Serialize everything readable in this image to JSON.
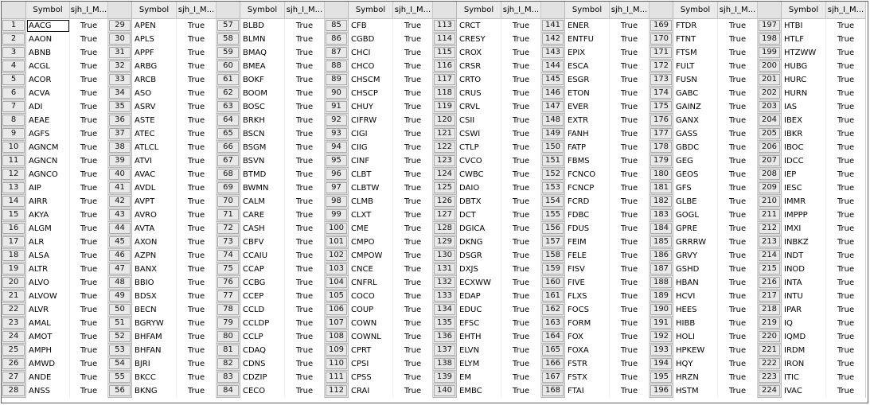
{
  "table": {
    "columns": {
      "symbol": "Symbol",
      "flag": "sjh_I_M..."
    },
    "rows": [
      {
        "idx": "1",
        "symbol": "AACG",
        "value": "True"
      },
      {
        "idx": "2",
        "symbol": "AAON",
        "value": "True"
      },
      {
        "idx": "3",
        "symbol": "ABNB",
        "value": "True"
      },
      {
        "idx": "4",
        "symbol": "ACGL",
        "value": "True"
      },
      {
        "idx": "5",
        "symbol": "ACOR",
        "value": "True"
      },
      {
        "idx": "6",
        "symbol": "ACVA",
        "value": "True"
      },
      {
        "idx": "7",
        "symbol": "ADI",
        "value": "True"
      },
      {
        "idx": "8",
        "symbol": "AEAE",
        "value": "True"
      },
      {
        "idx": "9",
        "symbol": "AGFS",
        "value": "True"
      },
      {
        "idx": "10",
        "symbol": "AGNCM",
        "value": "True"
      },
      {
        "idx": "11",
        "symbol": "AGNCN",
        "value": "True"
      },
      {
        "idx": "12",
        "symbol": "AGNCO",
        "value": "True"
      },
      {
        "idx": "13",
        "symbol": "AIP",
        "value": "True"
      },
      {
        "idx": "14",
        "symbol": "AIRR",
        "value": "True"
      },
      {
        "idx": "15",
        "symbol": "AKYA",
        "value": "True"
      },
      {
        "idx": "16",
        "symbol": "ALGM",
        "value": "True"
      },
      {
        "idx": "17",
        "symbol": "ALR",
        "value": "True"
      },
      {
        "idx": "18",
        "symbol": "ALSA",
        "value": "True"
      },
      {
        "idx": "19",
        "symbol": "ALTR",
        "value": "True"
      },
      {
        "idx": "20",
        "symbol": "ALVO",
        "value": "True"
      },
      {
        "idx": "21",
        "symbol": "ALVOW",
        "value": "True"
      },
      {
        "idx": "22",
        "symbol": "ALVR",
        "value": "True"
      },
      {
        "idx": "23",
        "symbol": "AMAL",
        "value": "True"
      },
      {
        "idx": "24",
        "symbol": "AMOT",
        "value": "True"
      },
      {
        "idx": "25",
        "symbol": "AMPH",
        "value": "True"
      },
      {
        "idx": "26",
        "symbol": "AMWD",
        "value": "True"
      },
      {
        "idx": "27",
        "symbol": "ANDE",
        "value": "True"
      },
      {
        "idx": "28",
        "symbol": "ANSS",
        "value": "True"
      },
      {
        "idx": "29",
        "symbol": "APEN",
        "value": "True"
      },
      {
        "idx": "30",
        "symbol": "APLS",
        "value": "True"
      },
      {
        "idx": "31",
        "symbol": "APPF",
        "value": "True"
      },
      {
        "idx": "32",
        "symbol": "ARBG",
        "value": "True"
      },
      {
        "idx": "33",
        "symbol": "ARCB",
        "value": "True"
      },
      {
        "idx": "34",
        "symbol": "ASO",
        "value": "True"
      },
      {
        "idx": "35",
        "symbol": "ASRV",
        "value": "True"
      },
      {
        "idx": "36",
        "symbol": "ASTE",
        "value": "True"
      },
      {
        "idx": "37",
        "symbol": "ATEC",
        "value": "True"
      },
      {
        "idx": "38",
        "symbol": "ATLCL",
        "value": "True"
      },
      {
        "idx": "39",
        "symbol": "ATVI",
        "value": "True"
      },
      {
        "idx": "40",
        "symbol": "AVAC",
        "value": "True"
      },
      {
        "idx": "41",
        "symbol": "AVDL",
        "value": "True"
      },
      {
        "idx": "42",
        "symbol": "AVPT",
        "value": "True"
      },
      {
        "idx": "43",
        "symbol": "AVRO",
        "value": "True"
      },
      {
        "idx": "44",
        "symbol": "AVTA",
        "value": "True"
      },
      {
        "idx": "45",
        "symbol": "AXON",
        "value": "True"
      },
      {
        "idx": "46",
        "symbol": "AZPN",
        "value": "True"
      },
      {
        "idx": "47",
        "symbol": "BANX",
        "value": "True"
      },
      {
        "idx": "48",
        "symbol": "BBIO",
        "value": "True"
      },
      {
        "idx": "49",
        "symbol": "BDSX",
        "value": "True"
      },
      {
        "idx": "50",
        "symbol": "BECN",
        "value": "True"
      },
      {
        "idx": "51",
        "symbol": "BGRYW",
        "value": "True"
      },
      {
        "idx": "52",
        "symbol": "BHFAM",
        "value": "True"
      },
      {
        "idx": "53",
        "symbol": "BHFAN",
        "value": "True"
      },
      {
        "idx": "54",
        "symbol": "BJRI",
        "value": "True"
      },
      {
        "idx": "55",
        "symbol": "BKCC",
        "value": "True"
      },
      {
        "idx": "56",
        "symbol": "BKNG",
        "value": "True"
      },
      {
        "idx": "57",
        "symbol": "BLBD",
        "value": "True"
      },
      {
        "idx": "58",
        "symbol": "BLMN",
        "value": "True"
      },
      {
        "idx": "59",
        "symbol": "BMAQ",
        "value": "True"
      },
      {
        "idx": "60",
        "symbol": "BMEA",
        "value": "True"
      },
      {
        "idx": "61",
        "symbol": "BOKF",
        "value": "True"
      },
      {
        "idx": "62",
        "symbol": "BOOM",
        "value": "True"
      },
      {
        "idx": "63",
        "symbol": "BOSC",
        "value": "True"
      },
      {
        "idx": "64",
        "symbol": "BRKH",
        "value": "True"
      },
      {
        "idx": "65",
        "symbol": "BSCN",
        "value": "True"
      },
      {
        "idx": "66",
        "symbol": "BSGM",
        "value": "True"
      },
      {
        "idx": "67",
        "symbol": "BSVN",
        "value": "True"
      },
      {
        "idx": "68",
        "symbol": "BTMD",
        "value": "True"
      },
      {
        "idx": "69",
        "symbol": "BWMN",
        "value": "True"
      },
      {
        "idx": "70",
        "symbol": "CALM",
        "value": "True"
      },
      {
        "idx": "71",
        "symbol": "CARE",
        "value": "True"
      },
      {
        "idx": "72",
        "symbol": "CASH",
        "value": "True"
      },
      {
        "idx": "73",
        "symbol": "CBFV",
        "value": "True"
      },
      {
        "idx": "74",
        "symbol": "CCAIU",
        "value": "True"
      },
      {
        "idx": "75",
        "symbol": "CCAP",
        "value": "True"
      },
      {
        "idx": "76",
        "symbol": "CCBG",
        "value": "True"
      },
      {
        "idx": "77",
        "symbol": "CCEP",
        "value": "True"
      },
      {
        "idx": "78",
        "symbol": "CCLD",
        "value": "True"
      },
      {
        "idx": "79",
        "symbol": "CCLDP",
        "value": "True"
      },
      {
        "idx": "80",
        "symbol": "CCLP",
        "value": "True"
      },
      {
        "idx": "81",
        "symbol": "CDAQ",
        "value": "True"
      },
      {
        "idx": "82",
        "symbol": "CDNS",
        "value": "True"
      },
      {
        "idx": "83",
        "symbol": "CDZIP",
        "value": "True"
      },
      {
        "idx": "84",
        "symbol": "CECO",
        "value": "True"
      },
      {
        "idx": "85",
        "symbol": "CFB",
        "value": "True"
      },
      {
        "idx": "86",
        "symbol": "CGBD",
        "value": "True"
      },
      {
        "idx": "87",
        "symbol": "CHCI",
        "value": "True"
      },
      {
        "idx": "88",
        "symbol": "CHCO",
        "value": "True"
      },
      {
        "idx": "89",
        "symbol": "CHSCM",
        "value": "True"
      },
      {
        "idx": "90",
        "symbol": "CHSCP",
        "value": "True"
      },
      {
        "idx": "91",
        "symbol": "CHUY",
        "value": "True"
      },
      {
        "idx": "92",
        "symbol": "CIFRW",
        "value": "True"
      },
      {
        "idx": "93",
        "symbol": "CIGI",
        "value": "True"
      },
      {
        "idx": "94",
        "symbol": "CIIG",
        "value": "True"
      },
      {
        "idx": "95",
        "symbol": "CINF",
        "value": "True"
      },
      {
        "idx": "96",
        "symbol": "CLBT",
        "value": "True"
      },
      {
        "idx": "97",
        "symbol": "CLBTW",
        "value": "True"
      },
      {
        "idx": "98",
        "symbol": "CLMB",
        "value": "True"
      },
      {
        "idx": "99",
        "symbol": "CLXT",
        "value": "True"
      },
      {
        "idx": "100",
        "symbol": "CME",
        "value": "True"
      },
      {
        "idx": "101",
        "symbol": "CMPO",
        "value": "True"
      },
      {
        "idx": "102",
        "symbol": "CMPOW",
        "value": "True"
      },
      {
        "idx": "103",
        "symbol": "CNCE",
        "value": "True"
      },
      {
        "idx": "104",
        "symbol": "CNFRL",
        "value": "True"
      },
      {
        "idx": "105",
        "symbol": "COCO",
        "value": "True"
      },
      {
        "idx": "106",
        "symbol": "COUP",
        "value": "True"
      },
      {
        "idx": "107",
        "symbol": "COWN",
        "value": "True"
      },
      {
        "idx": "108",
        "symbol": "COWNL",
        "value": "True"
      },
      {
        "idx": "109",
        "symbol": "CPRT",
        "value": "True"
      },
      {
        "idx": "110",
        "symbol": "CPSI",
        "value": "True"
      },
      {
        "idx": "111",
        "symbol": "CPSS",
        "value": "True"
      },
      {
        "idx": "112",
        "symbol": "CRAI",
        "value": "True"
      },
      {
        "idx": "113",
        "symbol": "CRCT",
        "value": "True"
      },
      {
        "idx": "114",
        "symbol": "CRESY",
        "value": "True"
      },
      {
        "idx": "115",
        "symbol": "CROX",
        "value": "True"
      },
      {
        "idx": "116",
        "symbol": "CRSR",
        "value": "True"
      },
      {
        "idx": "117",
        "symbol": "CRTO",
        "value": "True"
      },
      {
        "idx": "118",
        "symbol": "CRUS",
        "value": "True"
      },
      {
        "idx": "119",
        "symbol": "CRVL",
        "value": "True"
      },
      {
        "idx": "120",
        "symbol": "CSII",
        "value": "True"
      },
      {
        "idx": "121",
        "symbol": "CSWI",
        "value": "True"
      },
      {
        "idx": "122",
        "symbol": "CTLP",
        "value": "True"
      },
      {
        "idx": "123",
        "symbol": "CVCO",
        "value": "True"
      },
      {
        "idx": "124",
        "symbol": "CWBC",
        "value": "True"
      },
      {
        "idx": "125",
        "symbol": "DAIO",
        "value": "True"
      },
      {
        "idx": "126",
        "symbol": "DBTX",
        "value": "True"
      },
      {
        "idx": "127",
        "symbol": "DCT",
        "value": "True"
      },
      {
        "idx": "128",
        "symbol": "DGICA",
        "value": "True"
      },
      {
        "idx": "129",
        "symbol": "DKNG",
        "value": "True"
      },
      {
        "idx": "130",
        "symbol": "DSGR",
        "value": "True"
      },
      {
        "idx": "131",
        "symbol": "DXJS",
        "value": "True"
      },
      {
        "idx": "132",
        "symbol": "ECXWW",
        "value": "True"
      },
      {
        "idx": "133",
        "symbol": "EDAP",
        "value": "True"
      },
      {
        "idx": "134",
        "symbol": "EDUC",
        "value": "True"
      },
      {
        "idx": "135",
        "symbol": "EFSC",
        "value": "True"
      },
      {
        "idx": "136",
        "symbol": "EHTH",
        "value": "True"
      },
      {
        "idx": "137",
        "symbol": "ELVN",
        "value": "True"
      },
      {
        "idx": "138",
        "symbol": "ELYM",
        "value": "True"
      },
      {
        "idx": "139",
        "symbol": "EM",
        "value": "True"
      },
      {
        "idx": "140",
        "symbol": "EMBC",
        "value": "True"
      },
      {
        "idx": "141",
        "symbol": "ENER",
        "value": "True"
      },
      {
        "idx": "142",
        "symbol": "ENTFU",
        "value": "True"
      },
      {
        "idx": "143",
        "symbol": "EPIX",
        "value": "True"
      },
      {
        "idx": "144",
        "symbol": "ESCA",
        "value": "True"
      },
      {
        "idx": "145",
        "symbol": "ESGR",
        "value": "True"
      },
      {
        "idx": "146",
        "symbol": "ETON",
        "value": "True"
      },
      {
        "idx": "147",
        "symbol": "EVER",
        "value": "True"
      },
      {
        "idx": "148",
        "symbol": "EXTR",
        "value": "True"
      },
      {
        "idx": "149",
        "symbol": "FANH",
        "value": "True"
      },
      {
        "idx": "150",
        "symbol": "FATP",
        "value": "True"
      },
      {
        "idx": "151",
        "symbol": "FBMS",
        "value": "True"
      },
      {
        "idx": "152",
        "symbol": "FCNCO",
        "value": "True"
      },
      {
        "idx": "153",
        "symbol": "FCNCP",
        "value": "True"
      },
      {
        "idx": "154",
        "symbol": "FCRD",
        "value": "True"
      },
      {
        "idx": "155",
        "symbol": "FDBC",
        "value": "True"
      },
      {
        "idx": "156",
        "symbol": "FDUS",
        "value": "True"
      },
      {
        "idx": "157",
        "symbol": "FEIM",
        "value": "True"
      },
      {
        "idx": "158",
        "symbol": "FELE",
        "value": "True"
      },
      {
        "idx": "159",
        "symbol": "FISV",
        "value": "True"
      },
      {
        "idx": "160",
        "symbol": "FIVE",
        "value": "True"
      },
      {
        "idx": "161",
        "symbol": "FLXS",
        "value": "True"
      },
      {
        "idx": "162",
        "symbol": "FOCS",
        "value": "True"
      },
      {
        "idx": "163",
        "symbol": "FORM",
        "value": "True"
      },
      {
        "idx": "164",
        "symbol": "FOX",
        "value": "True"
      },
      {
        "idx": "165",
        "symbol": "FOXA",
        "value": "True"
      },
      {
        "idx": "166",
        "symbol": "FSTR",
        "value": "True"
      },
      {
        "idx": "167",
        "symbol": "FSTX",
        "value": "True"
      },
      {
        "idx": "168",
        "symbol": "FTAI",
        "value": "True"
      },
      {
        "idx": "169",
        "symbol": "FTDR",
        "value": "True"
      },
      {
        "idx": "170",
        "symbol": "FTNT",
        "value": "True"
      },
      {
        "idx": "171",
        "symbol": "FTSM",
        "value": "True"
      },
      {
        "idx": "172",
        "symbol": "FULT",
        "value": "True"
      },
      {
        "idx": "173",
        "symbol": "FUSN",
        "value": "True"
      },
      {
        "idx": "174",
        "symbol": "GABC",
        "value": "True"
      },
      {
        "idx": "175",
        "symbol": "GAINZ",
        "value": "True"
      },
      {
        "idx": "176",
        "symbol": "GANX",
        "value": "True"
      },
      {
        "idx": "177",
        "symbol": "GASS",
        "value": "True"
      },
      {
        "idx": "178",
        "symbol": "GBDC",
        "value": "True"
      },
      {
        "idx": "179",
        "symbol": "GEG",
        "value": "True"
      },
      {
        "idx": "180",
        "symbol": "GEOS",
        "value": "True"
      },
      {
        "idx": "181",
        "symbol": "GFS",
        "value": "True"
      },
      {
        "idx": "182",
        "symbol": "GLBE",
        "value": "True"
      },
      {
        "idx": "183",
        "symbol": "GOGL",
        "value": "True"
      },
      {
        "idx": "184",
        "symbol": "GPRE",
        "value": "True"
      },
      {
        "idx": "185",
        "symbol": "GRRRW",
        "value": "True"
      },
      {
        "idx": "186",
        "symbol": "GRVY",
        "value": "True"
      },
      {
        "idx": "187",
        "symbol": "GSHD",
        "value": "True"
      },
      {
        "idx": "188",
        "symbol": "HBAN",
        "value": "True"
      },
      {
        "idx": "189",
        "symbol": "HCVI",
        "value": "True"
      },
      {
        "idx": "190",
        "symbol": "HEES",
        "value": "True"
      },
      {
        "idx": "191",
        "symbol": "HIBB",
        "value": "True"
      },
      {
        "idx": "192",
        "symbol": "HOLI",
        "value": "True"
      },
      {
        "idx": "193",
        "symbol": "HPKEW",
        "value": "True"
      },
      {
        "idx": "194",
        "symbol": "HQY",
        "value": "True"
      },
      {
        "idx": "195",
        "symbol": "HRZN",
        "value": "True"
      },
      {
        "idx": "196",
        "symbol": "HSTM",
        "value": "True"
      },
      {
        "idx": "197",
        "symbol": "HTBI",
        "value": "True"
      },
      {
        "idx": "198",
        "symbol": "HTLF",
        "value": "True"
      },
      {
        "idx": "199",
        "symbol": "HTZWW",
        "value": "True"
      },
      {
        "idx": "200",
        "symbol": "HUBG",
        "value": "True"
      },
      {
        "idx": "201",
        "symbol": "HURC",
        "value": "True"
      },
      {
        "idx": "202",
        "symbol": "HURN",
        "value": "True"
      },
      {
        "idx": "203",
        "symbol": "IAS",
        "value": "True"
      },
      {
        "idx": "204",
        "symbol": "IBEX",
        "value": "True"
      },
      {
        "idx": "205",
        "symbol": "IBKR",
        "value": "True"
      },
      {
        "idx": "206",
        "symbol": "IBOC",
        "value": "True"
      },
      {
        "idx": "207",
        "symbol": "IDCC",
        "value": "True"
      },
      {
        "idx": "208",
        "symbol": "IEP",
        "value": "True"
      },
      {
        "idx": "209",
        "symbol": "IESC",
        "value": "True"
      },
      {
        "idx": "210",
        "symbol": "IMMR",
        "value": "True"
      },
      {
        "idx": "211",
        "symbol": "IMPPP",
        "value": "True"
      },
      {
        "idx": "212",
        "symbol": "IMXI",
        "value": "True"
      },
      {
        "idx": "213",
        "symbol": "INBKZ",
        "value": "True"
      },
      {
        "idx": "214",
        "symbol": "INDT",
        "value": "True"
      },
      {
        "idx": "215",
        "symbol": "INOD",
        "value": "True"
      },
      {
        "idx": "216",
        "symbol": "INTA",
        "value": "True"
      },
      {
        "idx": "217",
        "symbol": "INTU",
        "value": "True"
      },
      {
        "idx": "218",
        "symbol": "IPAR",
        "value": "True"
      },
      {
        "idx": "219",
        "symbol": "IQ",
        "value": "True"
      },
      {
        "idx": "220",
        "symbol": "IQMD",
        "value": "True"
      },
      {
        "idx": "221",
        "symbol": "IRDM",
        "value": "True"
      },
      {
        "idx": "222",
        "symbol": "IRON",
        "value": "True"
      },
      {
        "idx": "223",
        "symbol": "ITIC",
        "value": "True"
      },
      {
        "idx": "224",
        "symbol": "IVAC",
        "value": "True"
      }
    ],
    "selected_symbol": "AACG"
  }
}
